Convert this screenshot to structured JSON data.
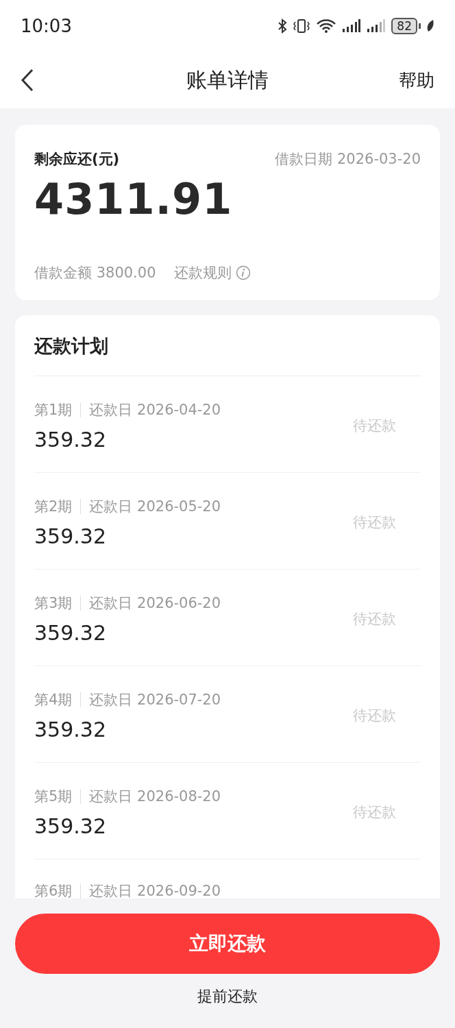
{
  "status_bar": {
    "time": "10:03",
    "battery": "82"
  },
  "nav": {
    "title": "账单详情",
    "action": "帮助"
  },
  "summary": {
    "label": "剩余应还(元)",
    "loan_date_label": "借款日期",
    "loan_date": "2026-03-20",
    "amount": "4311.91",
    "principal_label": "借款金额",
    "principal": "3800.00",
    "rules_link": "还款规则"
  },
  "plan": {
    "title": "还款计划",
    "rows": [
      {
        "period": "第1期",
        "due_label": "还款日",
        "due_date": "2026-04-20",
        "amount": "359.32",
        "status": "待还款"
      },
      {
        "period": "第2期",
        "due_label": "还款日",
        "due_date": "2026-05-20",
        "amount": "359.32",
        "status": "待还款"
      },
      {
        "period": "第3期",
        "due_label": "还款日",
        "due_date": "2026-06-20",
        "amount": "359.32",
        "status": "待还款"
      },
      {
        "period": "第4期",
        "due_label": "还款日",
        "due_date": "2026-07-20",
        "amount": "359.32",
        "status": "待还款"
      },
      {
        "period": "第5期",
        "due_label": "还款日",
        "due_date": "2026-08-20",
        "amount": "359.32",
        "status": "待还款"
      },
      {
        "period": "第6期",
        "due_label": "还款日",
        "due_date": "2026-09-20"
      }
    ]
  },
  "buttons": {
    "primary": "立即还款",
    "secondary": "提前还款"
  }
}
